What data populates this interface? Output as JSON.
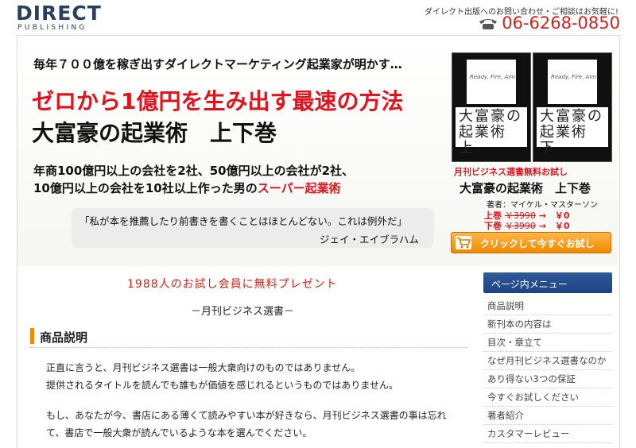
{
  "header": {
    "logo_main": "DIRECT",
    "logo_sub": "PUBLISHING",
    "contact_note": "ダイレクト出版へのお問い合わせ・ご相談はお気軽に!",
    "phone": "06-6268-0850",
    "phone_icon": "telephone-icon"
  },
  "hero": {
    "tagline": "毎年７００億を稼ぎ出すダイレクトマーケティング起業家が明かす…",
    "title_red": "ゼロから1億円を生み出す最速の方法",
    "title_black": "大富豪の起業術　上下巻",
    "desc_line1": "年商100億円以上の会社を2社、50億円以上の会社が2社、",
    "desc_line2_prefix": "10億円以上の会社を10社以上作った男の",
    "desc_line2_highlight": "スーパー起業術",
    "quote": "「私が本を推薦したり前書きを書くことはほとんどない。これは例外だ」",
    "quote_author": "ジェイ・エイブラハム"
  },
  "books": [
    {
      "cover_title": "Ready, Fire, Aim",
      "spine": "大富豪の起業術 上"
    },
    {
      "cover_title": "Ready, Fire, Aim",
      "spine": "大富豪の起業術 下"
    }
  ],
  "sidebar_offer": {
    "trial_label": "月刊ビジネス選書無料お試し",
    "title": "大富豪の起業術　上下巻",
    "author": "著者：マイケル・マスターソン",
    "vol1_label": "上巻",
    "vol1_old": "￥3990",
    "vol1_new": "→　￥0",
    "vol2_label": "下巻",
    "vol2_old": "￥3990",
    "vol2_new": "→　￥0",
    "cta_label": "クリックして今すぐお試し",
    "cart_icon": "cart-icon"
  },
  "main": {
    "present": "1988人のお試し会員に無料プレゼント",
    "magazine": "－月刊ビジネス選書－",
    "section_title": "商品説明",
    "p1_line1": "正直に言うと、月刊ビジネス選書は一般大衆向けのものではありません。",
    "p1_line2": "提供されるタイトルを読んでも誰もが価値を感じれるというものではありません。",
    "p2_line1": "もし、あなたが今、書店にある薄くて読みやすい本が好きなら、月刊ビジネス選書の事は忘れ",
    "p2_line2": "て、書店で一般大衆が読んでいるような本を選んでください。"
  },
  "menu": {
    "heading": "ページ内メニュー",
    "items": [
      "商品説明",
      "新刊本の内容は",
      "目次・章立て",
      "なぜ月刊ビジネス選書なのか",
      "あり得ない3つの保証",
      "今すぐお試しください",
      "著者紹介",
      "カスタマーレビュー"
    ]
  },
  "colors": {
    "accent_red": "#e0141e",
    "brand_navy": "#2a3f5e",
    "cta_orange": "#f08a00",
    "menu_blue": "#1d4283"
  }
}
